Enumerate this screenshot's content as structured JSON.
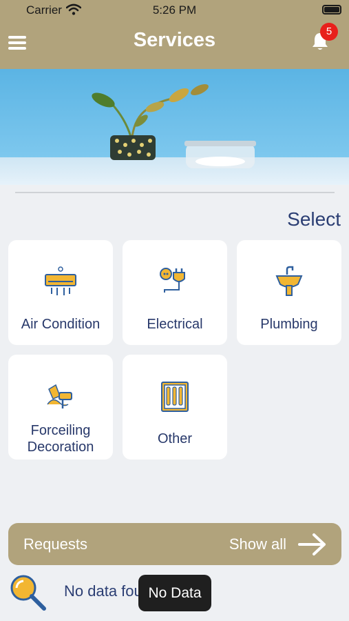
{
  "status_bar": {
    "carrier": "Carrier",
    "time": "5:26 PM"
  },
  "nav": {
    "title": "Services",
    "notification_count": "5"
  },
  "section": {
    "select_label": "Select"
  },
  "services": [
    {
      "label": "Air Condition",
      "icon": "air-conditioner-icon"
    },
    {
      "label": "Electrical",
      "icon": "electrical-plug-icon"
    },
    {
      "label": "Plumbing",
      "icon": "sink-faucet-icon"
    },
    {
      "label_lines": [
        "Forceiling",
        "Decoration"
      ],
      "icon": "paint-roller-icon"
    },
    {
      "label": "Other",
      "icon": "toolbox-icon"
    }
  ],
  "requests": {
    "title": "Requests",
    "show_all": "Show all"
  },
  "empty_state": {
    "text": "No data found"
  },
  "toast": {
    "text": "No Data"
  },
  "colors": {
    "header": "#b1a37c",
    "accent_text": "#2b3e73",
    "icon_blue": "#2e5f9e",
    "icon_yellow": "#f2b632",
    "badge": "#e8201c"
  }
}
